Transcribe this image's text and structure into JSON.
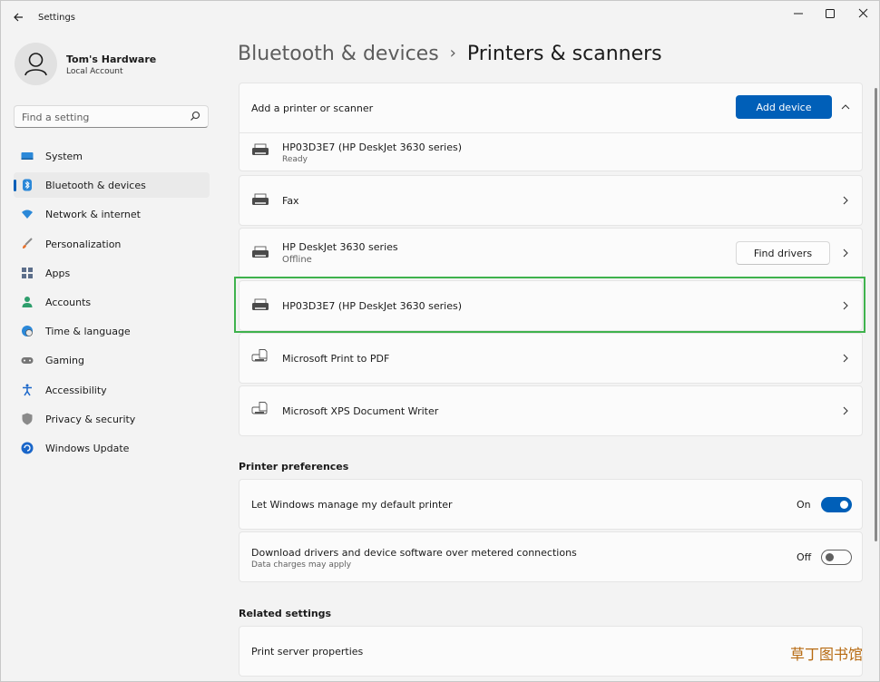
{
  "window": {
    "title": "Settings"
  },
  "account": {
    "name": "Tom's Hardware",
    "type": "Local Account"
  },
  "search": {
    "placeholder": "Find a setting"
  },
  "nav": [
    {
      "label": "System",
      "icon": "monitor-icon"
    },
    {
      "label": "Bluetooth & devices",
      "icon": "bluetooth-icon",
      "active": true
    },
    {
      "label": "Network & internet",
      "icon": "wifi-icon"
    },
    {
      "label": "Personalization",
      "icon": "brush-icon"
    },
    {
      "label": "Apps",
      "icon": "apps-icon"
    },
    {
      "label": "Accounts",
      "icon": "person-icon"
    },
    {
      "label": "Time & language",
      "icon": "globe-clock-icon"
    },
    {
      "label": "Gaming",
      "icon": "gamepad-icon"
    },
    {
      "label": "Accessibility",
      "icon": "accessibility-icon"
    },
    {
      "label": "Privacy & security",
      "icon": "shield-icon"
    },
    {
      "label": "Windows Update",
      "icon": "update-icon"
    }
  ],
  "breadcrumb": {
    "parent": "Bluetooth & devices",
    "separator": "›",
    "current": "Printers & scanners"
  },
  "add_printer": {
    "label": "Add a printer or scanner",
    "button": "Add device",
    "first_printer": {
      "name": "HP03D3E7 (HP DeskJet 3630 series)",
      "status": "Ready"
    }
  },
  "printers": [
    {
      "name": "Fax",
      "status": ""
    },
    {
      "name": "HP DeskJet 3630 series",
      "status": "Offline",
      "action": "Find drivers"
    },
    {
      "name": "HP03D3E7 (HP DeskJet 3630 series)",
      "status": ""
    },
    {
      "name": "Microsoft Print to PDF",
      "status": ""
    },
    {
      "name": "Microsoft XPS Document Writer",
      "status": ""
    }
  ],
  "printer_preferences": {
    "header": "Printer preferences",
    "items": [
      {
        "label": "Let Windows manage my default printer",
        "sub": "",
        "state": "On"
      },
      {
        "label": "Download drivers and device software over metered connections",
        "sub": "Data charges may apply",
        "state": "Off"
      }
    ]
  },
  "related_settings": {
    "header": "Related settings",
    "items": [
      {
        "label": "Print server properties"
      }
    ]
  },
  "watermark": "草丁图书馆",
  "colors": {
    "accent": "#005fb8",
    "highlight": "#3fb24d"
  }
}
